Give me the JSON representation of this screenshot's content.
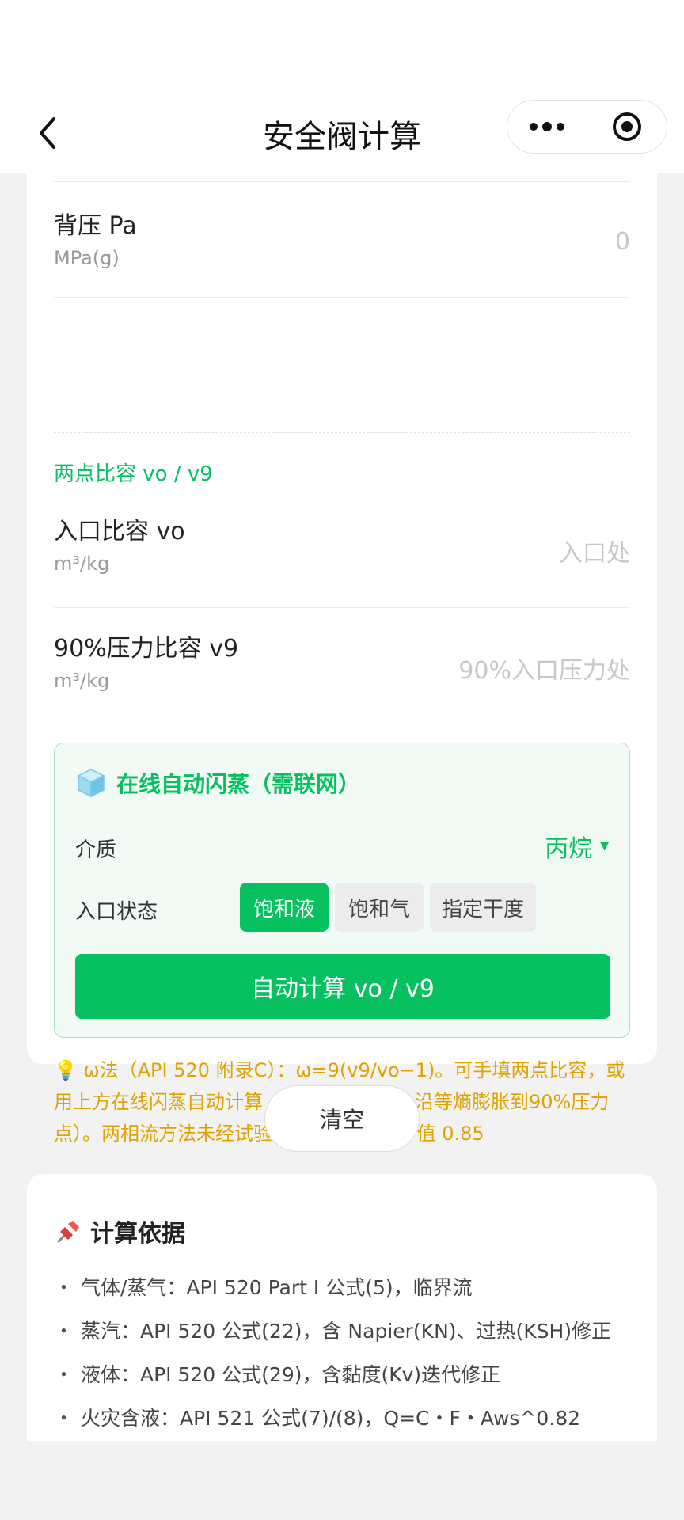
{
  "nav": {
    "title": "安全阀计算"
  },
  "fields": {
    "back_pressure": {
      "label": "背压 Pa",
      "unit": "MPa(g)",
      "value": "0"
    },
    "section_label": "两点比容 vo / v9",
    "inlet_volume": {
      "label": "入口比容 vo",
      "unit": "m³/kg",
      "placeholder": "入口处"
    },
    "volume_90": {
      "label": "90%压力比容 v9",
      "unit": "m³/kg",
      "placeholder": "90%入口压力处"
    }
  },
  "flash": {
    "title": "在线自动闪蒸（需联网）",
    "medium_label": "介质",
    "medium_value": "丙烷",
    "state_label": "入口状态",
    "states": [
      "饱和液",
      "饱和气",
      "指定干度"
    ],
    "active_state": "饱和液",
    "auto_button": "自动计算 vo / v9"
  },
  "note": "💡 ω法（API 520 附录C）：ω=9(v9/vo−1)。可手填两点比容，或用上方在线闪蒸自动计算（基于入口压力，沿等熵膨胀到90%压力点）。两相流方法未经试验验证，Kd 取保守值 0.85",
  "clear_button": "清空",
  "basis": {
    "title": "计算依据",
    "items": [
      "气体/蒸气：API 520 Part I 公式(5)，临界流",
      "蒸汽：API 520 公式(22)，含 Napier(KN)、过热(KSH)修正",
      "液体：API 520 公式(29)，含黏度(Kv)迭代修正",
      "火灾含液：API 521 公式(7)/(8)，Q=C・F・Aws^0.82"
    ]
  },
  "colors": {
    "accent": "#07c160",
    "note": "#e0a200"
  }
}
